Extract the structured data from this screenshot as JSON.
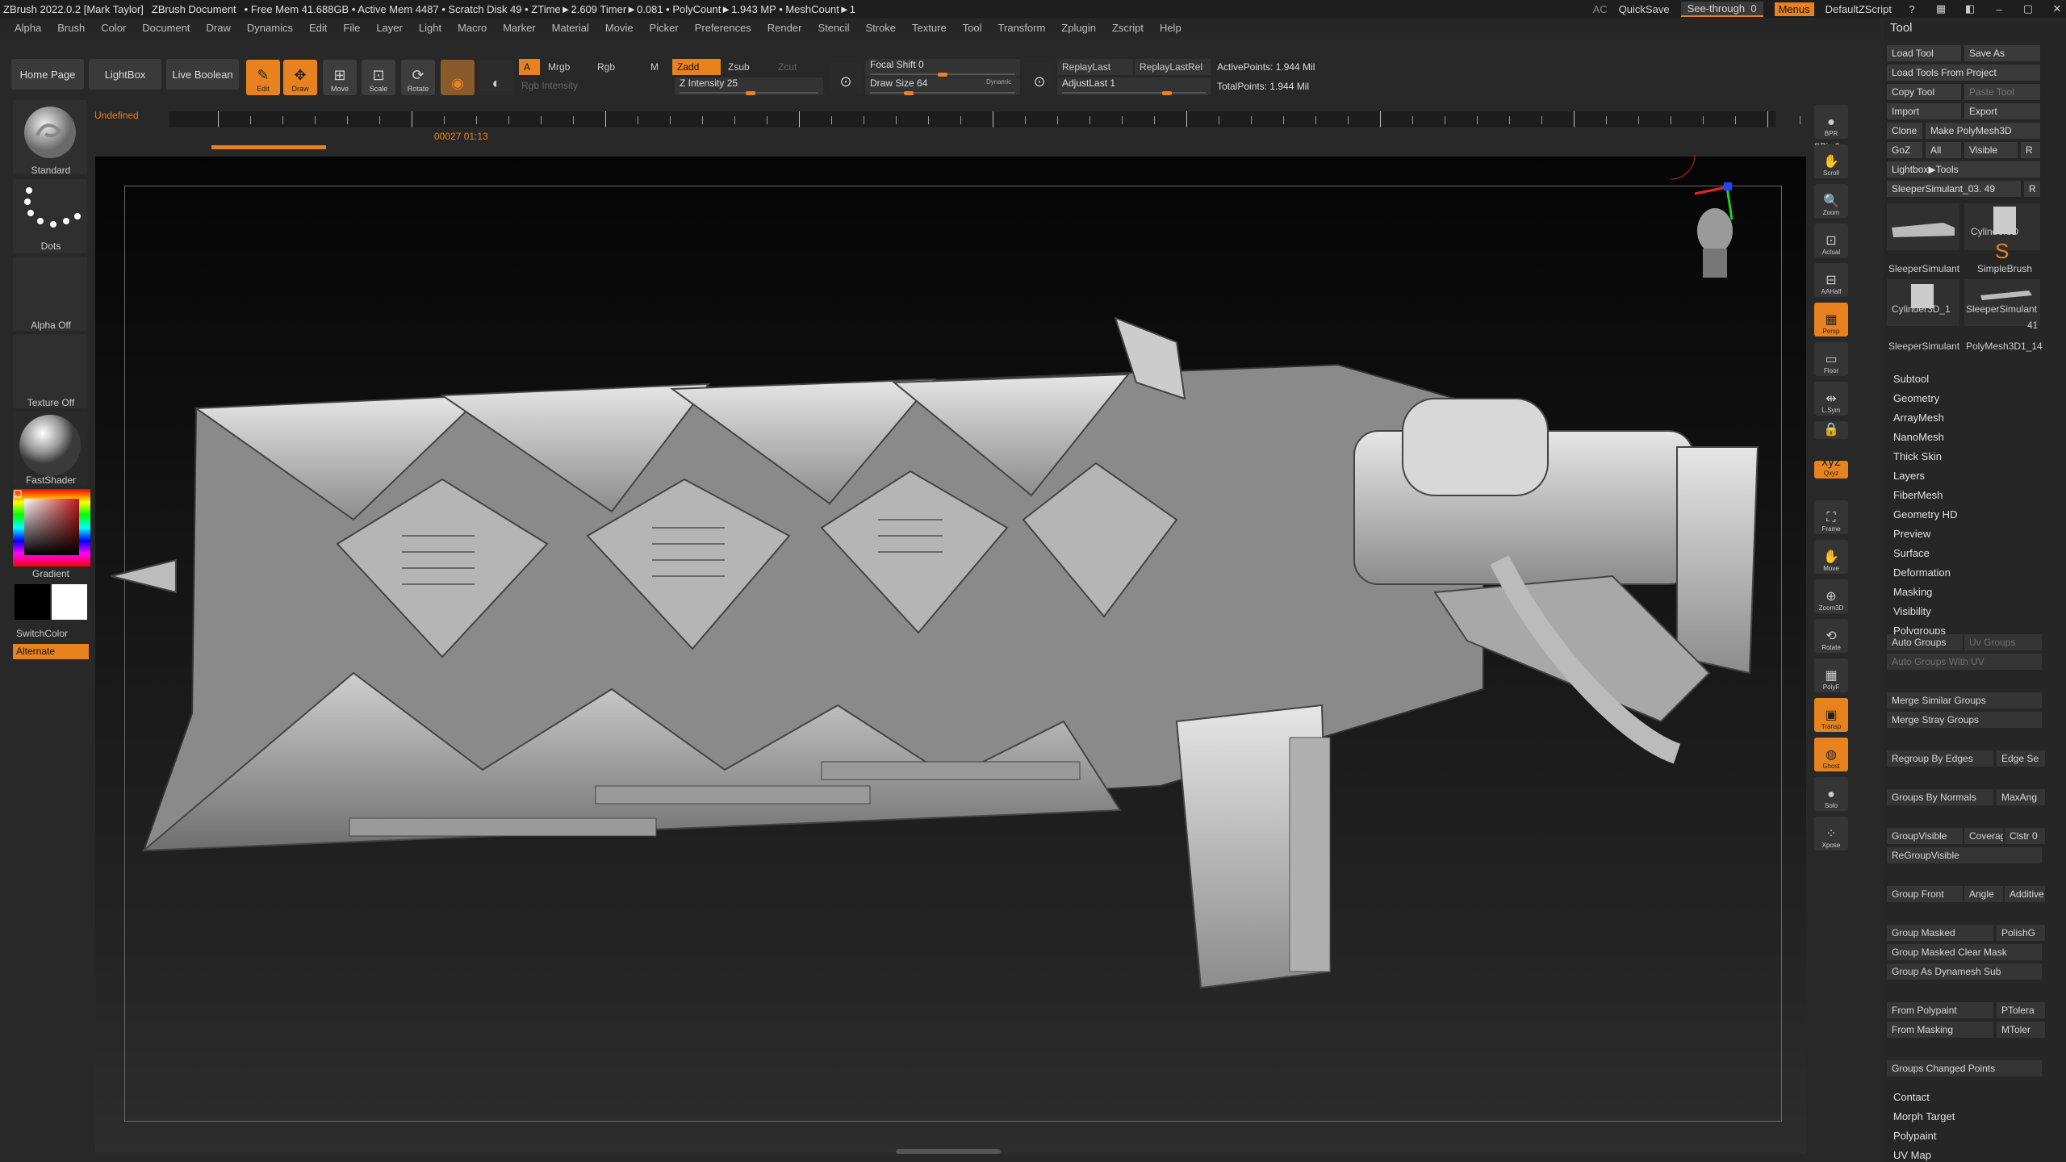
{
  "titlebar": {
    "app": "ZBrush 2022.0.2 [Mark Taylor]",
    "document": "ZBrush Document",
    "stats": "• Free Mem 41.688GB • Active Mem 4487 • Scratch Disk 49 • ZTime►2.609 Timer►0.081 • PolyCount►1.943 MP • MeshCount►1",
    "ac": "AC",
    "quicksave": "QuickSave",
    "seethrough": "See-through",
    "seethrough_value": "0",
    "menus": "Menus",
    "script": "DefaultZScript"
  },
  "menubar": [
    "Alpha",
    "Brush",
    "Color",
    "Document",
    "Draw",
    "Dynamics",
    "Edit",
    "File",
    "Layer",
    "Light",
    "Macro",
    "Marker",
    "Material",
    "Movie",
    "Picker",
    "Preferences",
    "Render",
    "Stencil",
    "Stroke",
    "Texture",
    "Tool",
    "Transform",
    "Zplugin",
    "Zscript",
    "Help"
  ],
  "shelf": {
    "home": "Home Page",
    "lightbox": "LightBox",
    "liveboolean": "Live Boolean",
    "edit": "Edit",
    "draw": "Draw",
    "move": "Move",
    "scale": "Scale",
    "rotate": "Rotate",
    "a": "A",
    "mrgb": "Mrgb",
    "rgb": "Rgb",
    "m": "M",
    "rgb_intensity": "Rgb Intensity",
    "zadd": "Zadd",
    "zsub": "Zsub",
    "zcut": "Zcut",
    "z_intensity": "Z Intensity",
    "z_intensity_value": "25",
    "focal_shift": "Focal Shift",
    "focal_shift_value": "0",
    "draw_size": "Draw Size",
    "draw_size_value": "64",
    "dynamic": "Dynamic",
    "replaylast": "ReplayLast",
    "replaylastrel": "ReplayLastRel",
    "adjustlast": "AdjustLast",
    "adjustlast_value": "1",
    "active_points": "ActivePoints: 1.944 Mil",
    "total_points": "TotalPoints: 1.944 Mil"
  },
  "timeline": {
    "label": "Undefined",
    "time": "00027 01:13"
  },
  "left": {
    "brush": "Standard",
    "stroke": "Dots",
    "alpha": "Alpha Off",
    "texture": "Texture Off",
    "material": "FastShader",
    "gradient": "Gradient",
    "switchcolor": "SwitchColor",
    "alternate": "Alternate"
  },
  "rtools": [
    {
      "name": "bpr",
      "label": "BPR",
      "active": false
    },
    {
      "name": "scroll",
      "label": "Scroll",
      "active": false
    },
    {
      "name": "zoom",
      "label": "Zoom",
      "active": false
    },
    {
      "name": "actual",
      "label": "Actual",
      "active": false
    },
    {
      "name": "aahalf",
      "label": "AAHalf",
      "active": false
    },
    {
      "name": "persp",
      "label": "Persp",
      "active": true
    },
    {
      "name": "floor",
      "label": "Floor",
      "active": false
    },
    {
      "name": "lsym",
      "label": "L.Sym",
      "active": false
    },
    {
      "name": "lock",
      "label": "",
      "active": false
    },
    {
      "name": "xyz",
      "label": "Qxyz",
      "active": true
    },
    {
      "name": "frame",
      "label": "Frame",
      "active": false
    },
    {
      "name": "move",
      "label": "Move",
      "active": false
    },
    {
      "name": "zoom3d",
      "label": "Zoom3D",
      "active": false
    },
    {
      "name": "rotate",
      "label": "Rotate",
      "active": false
    },
    {
      "name": "polyf",
      "label": "PolyF",
      "active": false
    },
    {
      "name": "transp",
      "label": "Transp",
      "active": true
    },
    {
      "name": "ghost",
      "label": "Ghost",
      "active": true
    },
    {
      "name": "solo",
      "label": "Solo",
      "active": false
    },
    {
      "name": "xpose",
      "label": "Xpose",
      "active": false
    }
  ],
  "spix": "SPix 3",
  "tool": {
    "title": "Tool",
    "load_tool": "Load Tool",
    "save_as": "Save As",
    "load_from_project": "Load Tools From Project",
    "copy_tool": "Copy Tool",
    "paste_tool": "Paste Tool",
    "import": "Import",
    "export": "Export",
    "clone": "Clone",
    "make_polymesh": "Make PolyMesh3D",
    "goz": "GoZ",
    "all": "All",
    "visible": "Visible",
    "r": "R",
    "lightbox_tools": "Lightbox▶Tools",
    "current": "SleeperSimulant_03. 49",
    "thumbs": [
      "SleeperSimulant",
      "Cylinder3D",
      "SimpleBrush",
      "Cylinder3D_1",
      "SleeperSimulant",
      "SleeperSimulant",
      "PolyMesh3D1_14"
    ],
    "thumb_count": "41",
    "sections": [
      "Subtool",
      "Geometry",
      "ArrayMesh",
      "NanoMesh",
      "Thick Skin",
      "Layers",
      "FiberMesh",
      "Geometry HD",
      "Preview",
      "Surface",
      "Deformation",
      "Masking",
      "Visibility",
      "Polygroups"
    ],
    "polygroups": {
      "auto_groups": "Auto Groups",
      "uv_groups": "Uv Groups",
      "auto_groups_uv": "Auto Groups With UV",
      "merge_similar": "Merge Similar Groups",
      "merge_stray": "Merge Stray Groups",
      "regroup_edges": "Regroup By Edges",
      "edge_se": "Edge Se",
      "groups_by_normals": "Groups By Normals",
      "maxang": "MaxAng",
      "groupvisible": "GroupVisible",
      "coverage": "Coverag",
      "clstr": "Clstr 0",
      "regroupvisible": "ReGroupVisible",
      "group_front": "Group Front",
      "angle": "Angle",
      "additive": "Additive",
      "group_masked": "Group Masked",
      "polishg": "PolishG",
      "group_masked_clear": "Group Masked Clear Mask",
      "group_as_dynamesh": "Group As Dynamesh Sub",
      "from_polypaint": "From Polypaint",
      "ptolera": "PTolera",
      "from_masking": "From Masking",
      "mtolera": "MToler",
      "groups_changed": "Groups Changed Points"
    },
    "tail_sections": [
      "Contact",
      "Morph Target",
      "Polypaint",
      "UV Map"
    ]
  },
  "colors": {
    "accent": "#e8821e",
    "panel": "#262626",
    "canvas": "#0a0a0a"
  }
}
